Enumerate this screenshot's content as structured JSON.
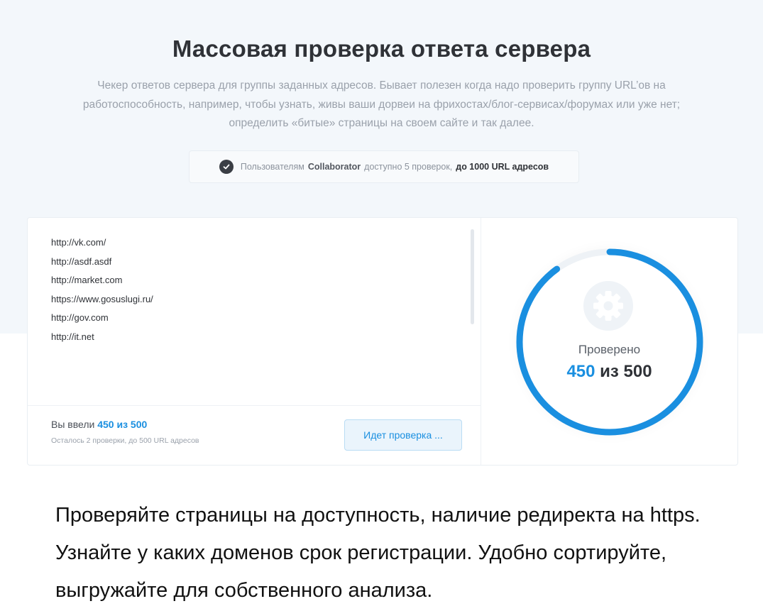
{
  "header": {
    "title": "Массовая проверка ответа сервера",
    "subtitle": "Чекер ответов сервера для группы заданных адресов. Бывает полезен когда надо проверить группу URL’ов на работоспособность, например, чтобы узнать, живы ваши дорвеи на фрихостах/блог-сервисах/форумах или уже нет; определить «битые» страницы на своем сайте и так далее."
  },
  "notice": {
    "icon": "check-circle-icon",
    "prefix": "Пользователям",
    "brand": "Collaborator",
    "middle": "доступно 5 проверок,",
    "highlight": "до 1000 URL адресов"
  },
  "url_list": [
    "http://vk.com/",
    "http://asdf.asdf",
    "http://market.com",
    "https://www.gosuslugi.ru/",
    "http://gov.com",
    "http://it.net"
  ],
  "input_footer": {
    "entered_label": "Вы ввели",
    "entered_value": "450 из 500",
    "remaining_text": "Осталось 2 проверки, до 500 URL адресов",
    "button_label": "Идет проверка ..."
  },
  "gauge": {
    "icon": "gear-icon",
    "label": "Проверено",
    "checked": 450,
    "total": 500,
    "checked_text": "450",
    "separator": "из",
    "total_text": "500",
    "accent_color": "#1a8fe0"
  },
  "promo": {
    "text": "Проверяйте страницы на доступность, наличие редиректа на https. Узнайте у каких доменов срок регистрации. Удобно сортируйте, выгружайте для собственного анализа."
  }
}
